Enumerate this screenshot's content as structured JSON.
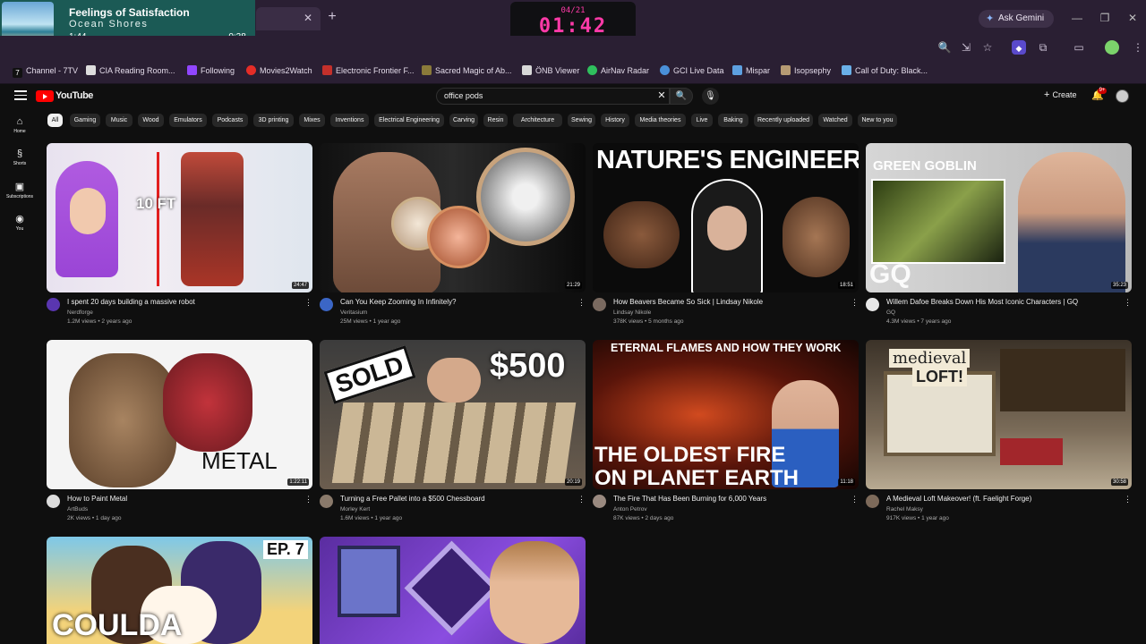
{
  "media": {
    "title": "Feelings of Satisfaction",
    "artist": "Ocean Shores",
    "current": "1:44",
    "remaining": "-0:38",
    "progress": 0.73
  },
  "clock": {
    "date": "04/21",
    "time": "01:42"
  },
  "browser": {
    "gemini": "Ask Gemini"
  },
  "bookmarks": [
    "Channel - 7TV",
    "CIA Reading Room...",
    "Following",
    "Movies2Watch",
    "Electronic Frontier F...",
    "Sacred Magic of Ab...",
    "ÖNB Viewer",
    "AirNav Radar",
    "GCI Live Data",
    "Mispar",
    "Isopsephy",
    "Call of Duty: Black..."
  ],
  "youtube": {
    "logo": "YouTube",
    "search_value": "office pods",
    "create": "Create",
    "notif_count": "9+",
    "nav": {
      "home": "Home",
      "shorts": "Shorts",
      "subs": "Subscriptions",
      "you": "You"
    },
    "chips": [
      "All",
      "Gaming",
      "Music",
      "Wood",
      "Emulators",
      "Podcasts",
      "3D printing",
      "Mixes",
      "Inventions",
      "Electrical Engineering",
      "Carving",
      "Resin",
      "Architecture",
      "Sewing",
      "History",
      "Media theories",
      "Live",
      "Baking",
      "Recently uploaded",
      "Watched",
      "New to you"
    ]
  },
  "videos": [
    {
      "title": "I spent 20 days building a massive robot",
      "channel": "Nerdforge",
      "meta": "1.2M views • 2 years ago",
      "duration": "24:47",
      "overlay": "10 FT"
    },
    {
      "title": "Can You Keep Zooming In Infinitely?",
      "channel": "Veritasium",
      "meta": "25M views • 1 year ago",
      "duration": "21:29",
      "overlay": ""
    },
    {
      "title": "How Beavers Became So Sick | Lindsay Nikole",
      "channel": "Lindsay Nikole",
      "meta": "378K views • 5 months ago",
      "duration": "18:51",
      "overlay": "NATURE'S ENGINEERS"
    },
    {
      "title": "Willem Dafoe Breaks Down His Most Iconic Characters | GQ",
      "channel": "GQ",
      "meta": "4.3M views • 7 years ago",
      "duration": "35:23",
      "overlay": "GREEN GOBLIN",
      "overlay2": "GQ"
    },
    {
      "title": "How to Paint Metal",
      "channel": "ArtBuds",
      "meta": "2K views • 1 day ago",
      "duration": "1:22:11",
      "overlay": "METAL"
    },
    {
      "title": "Turning a Free Pallet into a $500 Chessboard",
      "channel": "Morley Kert",
      "meta": "1.6M views • 1 year ago",
      "duration": "20:19",
      "overlay": "SOLD",
      "overlay2": "$500"
    },
    {
      "title": "The Fire That Has Been Burning for 6,000 Years",
      "channel": "Anton Petrov",
      "meta": "87K views • 2 days ago",
      "duration": "11:18",
      "overlay": "ETERNAL FLAMES AND HOW THEY WORK",
      "overlay2": "THE OLDEST FIRE",
      "overlay3": "ON PLANET EARTH"
    },
    {
      "title": "A Medieval Loft Makeover! (ft. Faelight Forge)",
      "channel": "Rachel Maksy",
      "meta": "917K views • 1 year ago",
      "duration": "30:58",
      "overlay": "medieval",
      "overlay2": "LOFT!"
    },
    {
      "overlay": "EP. 7",
      "overlay2": "COULDA"
    }
  ]
}
